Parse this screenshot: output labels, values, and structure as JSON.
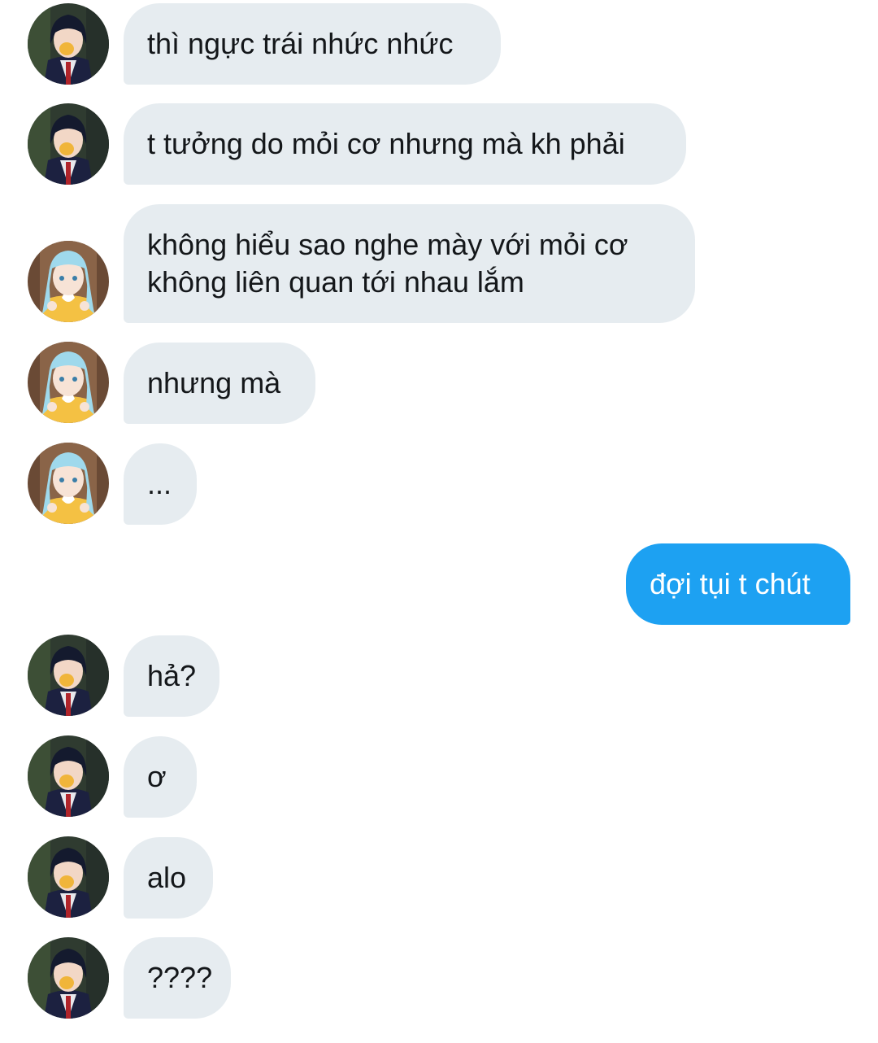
{
  "conversation": {
    "messages": [
      {
        "sender": "them",
        "text": "thì ngực trái nhức nhức"
      },
      {
        "sender": "them",
        "text": "t tưởng do mỏi cơ nhưng mà kh phải"
      },
      {
        "sender": "other",
        "lines": [
          "không hiểu sao nghe mày với mỏi cơ",
          "không liên quan tới nhau lắm"
        ]
      },
      {
        "sender": "other",
        "text": "nhưng mà"
      },
      {
        "sender": "other",
        "text": "..."
      },
      {
        "sender": "me",
        "text": "đợi tụi t chút"
      },
      {
        "sender": "them",
        "text": "hả?"
      },
      {
        "sender": "them",
        "text": "ơ"
      },
      {
        "sender": "them",
        "text": "alo"
      },
      {
        "sender": "them",
        "text": "????"
      }
    ],
    "avatars": {
      "dark_hair": "avatar-dark-hair-boy-icon",
      "blue_hair": "avatar-blue-hair-girl-icon"
    }
  },
  "colors": {
    "incoming_bubble": "#e6ecf0",
    "outgoing_bubble": "#1da1f2",
    "text_dark": "#14171a",
    "text_light": "#ffffff"
  }
}
